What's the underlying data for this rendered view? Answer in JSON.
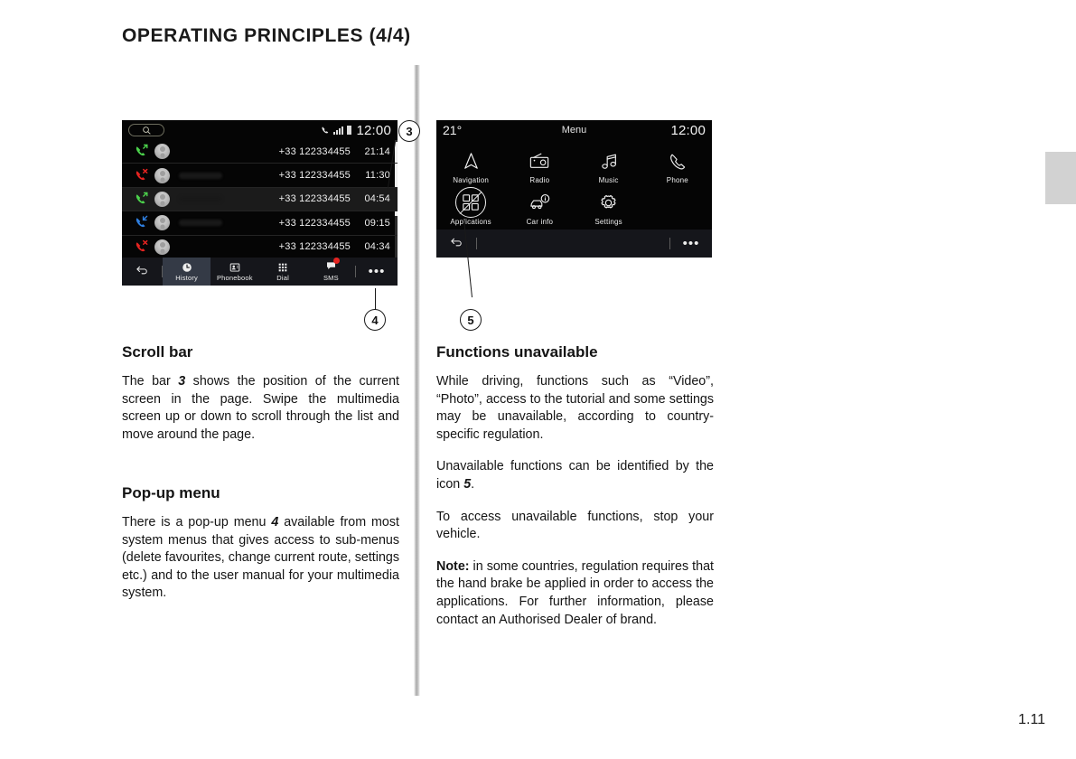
{
  "page": {
    "title": "OPERATING PRINCIPLES (4/4)",
    "number": "1.11"
  },
  "phone_screen": {
    "search_icon": "search-icon",
    "status": {
      "phone_icon": "phone-handset-icon",
      "signal_icon": "signal-bars-icon",
      "info_icon": "battery-icon",
      "clock": "12:00"
    },
    "calls": [
      {
        "direction": "outgoing",
        "color": "#4cd34c",
        "number": "+33 122334455",
        "time": "21:14",
        "highlighted": false,
        "name_hidden": false
      },
      {
        "direction": "missed",
        "color": "#e52421",
        "number": "+33 122334455",
        "time": "11:30",
        "highlighted": false,
        "name_hidden": true
      },
      {
        "direction": "outgoing",
        "color": "#4cd34c",
        "number": "+33 122334455",
        "time": "04:54",
        "highlighted": true,
        "name_hidden": true
      },
      {
        "direction": "incoming",
        "color": "#2f7fe0",
        "number": "+33 122334455",
        "time": "09:15",
        "highlighted": false,
        "name_hidden": true
      },
      {
        "direction": "missed",
        "color": "#e52421",
        "number": "+33 122334455",
        "time": "04:34",
        "highlighted": false,
        "name_hidden": false
      }
    ],
    "toolbar": {
      "back_label": "back-arrow-icon",
      "items": [
        {
          "label": "History",
          "icon": "clock-icon",
          "active": true
        },
        {
          "label": "Phonebook",
          "icon": "contact-card-icon",
          "active": false
        },
        {
          "label": "Dial",
          "icon": "keypad-icon",
          "active": false
        },
        {
          "label": "SMS",
          "icon": "message-bubble-icon",
          "active": false
        }
      ],
      "more_label": "•••"
    }
  },
  "menu_screen": {
    "temperature": "21°",
    "title": "Menu",
    "clock": "12:00",
    "tiles": [
      {
        "label": "Navigation",
        "icon": "navigation-arrow-icon",
        "unavailable": false
      },
      {
        "label": "Radio",
        "icon": "radio-icon",
        "unavailable": false
      },
      {
        "label": "Music",
        "icon": "music-note-icon",
        "unavailable": false
      },
      {
        "label": "Phone",
        "icon": "phone-handset-icon",
        "unavailable": false
      },
      {
        "label": "Applications",
        "icon": "apps-grid-icon",
        "unavailable": true
      },
      {
        "label": "Car info",
        "icon": "car-info-icon",
        "unavailable": false
      },
      {
        "label": "Settings",
        "icon": "gear-icon",
        "unavailable": false
      }
    ],
    "toolbar": {
      "back_label": "back-arrow-icon",
      "more_label": "•••"
    }
  },
  "callouts": {
    "scrollbar": "3",
    "popup": "4",
    "unavailable": "5"
  },
  "content": {
    "scroll_bar": {
      "heading": "Scroll bar",
      "p1_a": "The bar ",
      "p1_num": "3",
      "p1_b": " shows the position of the current screen in the page. Swipe the multimedia screen up or down to scroll through the list and move around the page."
    },
    "popup_menu": {
      "heading": "Pop-up menu",
      "p1_a": "There is a pop-up menu ",
      "p1_num": "4",
      "p1_b": " available from most system menus that gives access to sub-menus (delete favourites, change current route, settings etc.) and to the user manual for your multimedia system."
    },
    "functions_unavailable": {
      "heading": "Functions unavailable",
      "p1": "While driving, functions such as “Video”, “Photo”, access to the tutorial and some settings may be unavailable, according to country-specific regulation.",
      "p2_a": "Unavailable functions can be identified by the icon ",
      "p2_num": "5",
      "p2_b": ".",
      "p3": "To access unavailable functions, stop your vehicle.",
      "p4_label": "Note:",
      "p4_text": " in some countries, regulation requires that the hand brake be applied in order to access the applications. For further information, please contact an Authorised Dealer of brand."
    }
  }
}
